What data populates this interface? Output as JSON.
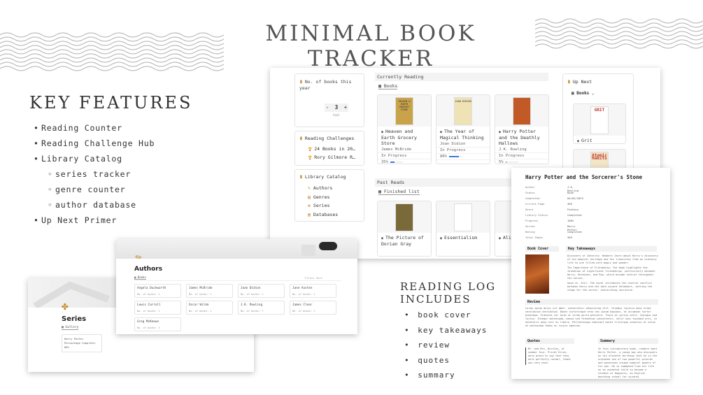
{
  "title": "MINIMAL BOOK TRACKER",
  "key_features": {
    "title": "KEY FEATURES",
    "items": [
      {
        "text": "Reading Counter",
        "level": 0
      },
      {
        "text": "Reading Challenge Hub",
        "level": 0
      },
      {
        "text": "Library Catalog",
        "level": 0
      },
      {
        "text": "series tracker",
        "level": 1
      },
      {
        "text": "genre counter",
        "level": 1
      },
      {
        "text": "author database",
        "level": 1
      },
      {
        "text": "Up Next Primer",
        "level": 0
      }
    ]
  },
  "reading_log": {
    "title_line1": "READING LOG",
    "title_line2": "INCLUDES",
    "items": [
      "book cover",
      "key takeaways",
      "review",
      "quotes",
      "summary"
    ]
  },
  "dashboard": {
    "counter": {
      "label": "No. of books this year",
      "value": "3",
      "minus": "-",
      "plus": "+",
      "sub": "Goal"
    },
    "challenges": {
      "label": "Reading Challenges",
      "items": [
        "24 Books in 20…",
        "Rory Gilmore R…"
      ]
    },
    "catalog": {
      "label": "Library Catalog",
      "items": [
        {
          "icon": "pencil-icon",
          "label": "Authors"
        },
        {
          "icon": "books-icon",
          "label": "Genres"
        },
        {
          "icon": "clover-icon",
          "label": "Series"
        },
        {
          "icon": "database-icon",
          "label": "Databases"
        }
      ]
    },
    "currently_reading": {
      "header": "Currently Reading",
      "tab": "Books",
      "books": [
        {
          "title": "Heaven and Earth Grocery Store",
          "author": "James McBride",
          "status": "In Progress",
          "progress_label": "35%",
          "progress": 0.35,
          "cover_color": "#c9a34a",
          "cover_text": "HEAVEN & EARTH GROCERY STORE"
        },
        {
          "title": "The Year of Magical Thinking",
          "author": "Joan Didion",
          "status": "In Progress",
          "progress_label": "80%",
          "progress": 0.8,
          "cover_color": "#efe2b5",
          "cover_text": "JOAN DIDION"
        },
        {
          "title": "Harry Potter and the Deathly Hallows",
          "author": "J.K. Rowling",
          "status": "In Progress",
          "progress_label": "5%",
          "progress": 0.05,
          "cover_color": "#c25a28",
          "cover_text": ""
        }
      ]
    },
    "past_reads": {
      "header": "Past Reads",
      "tab": "Finished list",
      "books": [
        {
          "title": "The Picture of Dorian Gray",
          "cover_color": "#7a6a3a"
        },
        {
          "title": "Essentialism",
          "cover_color": "#ffffff"
        },
        {
          "title": "Ali… Won…",
          "cover_color": "#5a8a9a"
        }
      ]
    },
    "up_next": {
      "header": "Up Next",
      "tab": "Books",
      "books": [
        {
          "title": "Grit",
          "cover_color": "#ffffff",
          "cover_text": "GRIT"
        },
        {
          "title": "Atomic Habits",
          "cover_color": "#f2e6c9",
          "cover_text": "Atomic Habits"
        }
      ]
    }
  },
  "harry_potter": {
    "title": "Harry Potter and the Sorcerer's Stone",
    "props": [
      {
        "k": "Author",
        "v": "J.K. Rowling"
      },
      {
        "k": "Status",
        "v": "Done"
      },
      {
        "k": "Completed",
        "v": "04/02/2023"
      },
      {
        "k": "Current Page",
        "v": "309"
      },
      {
        "k": "Genre",
        "v": "Fantasy"
      },
      {
        "k": "Library Status",
        "v": "Completed"
      },
      {
        "k": "Progress",
        "v": "100%"
      },
      {
        "k": "Series",
        "v": "Harry Potter"
      },
      {
        "k": "Rating",
        "v": "Completed"
      },
      {
        "k": "Total Pages",
        "v": "309"
      }
    ],
    "cover_label": "Book Cover",
    "takeaways_label": "Key Takeaways",
    "takeaways": [
      "Discovery of Identity: Readers learn about Harry's discovery of his magical heritage and his transition from an ordinary life to one filled with magic and wonder.",
      "The Importance of Friendship: The book highlights the formation of significant friendships, particularly between Harry, Hermione, and Ron, which become central throughout the series.",
      "Good vs. Evil: The novel introduces the central conflict between Harry and the dark wizard Voldemort, setting the stage for the series' overarching narrative."
    ],
    "review_label": "Review",
    "review_text": "Lorem ipsum dolor sit amet, consectetur adipiscing elit. Vivamus lacinia odio vitae vestibulum vestibulum. Donec scelerisque eros nec ipsum dapibus, at accumsan tortor bibendum. Praesent vel enim ut lorem porta pharetra. Fusce et varius velit. Quisque sed lectus. Integer malesuada, massa sed fermentum consectetur, velit nunc euismod orci, in hendrerit odio nisl eu libero. Pellentesque habitant morbi tristique senectus et netus et malesuada fames ac turpis egestas.",
    "quotes_label": "Quotes",
    "quote_text": "Mr. and Mrs. Dursley, of number four, Privet Drive, were proud to say that they were perfectly normal, thank you very much.",
    "summary_label": "Summary",
    "summary_text": "In this introductory book, readers meet Harry Potter, a young boy who discovers on his eleventh birthday that he is the orphaned son of two powerful wizards and possesses unique magical powers of his own. He is summoned from his life as an unwanted child to become a student at Hogwarts, an English boarding school for wizards."
  },
  "authors": {
    "title": "Authors",
    "tab": "Books",
    "toolbar": "Filter Sort",
    "cells": [
      {
        "name": "Angela Duckworth",
        "sub": "No. of books: 1"
      },
      {
        "name": "James McBride",
        "sub": "No. of books: 1"
      },
      {
        "name": "Joan Didion",
        "sub": "No. of books: 1"
      },
      {
        "name": "Jane Austen",
        "sub": "No. of books: 1"
      },
      {
        "name": "Lewis Carroll",
        "sub": "No. of books: 1"
      },
      {
        "name": "Oscar Wilde",
        "sub": "No. of books: 1"
      },
      {
        "name": "J.K. Rowling",
        "sub": "No. of books: 7"
      },
      {
        "name": "James Clear",
        "sub": "No. of books: 1"
      },
      {
        "name": "Greg McKeown",
        "sub": "No. of books: 1"
      }
    ]
  },
  "series": {
    "title": "Series",
    "tab": "Gallery",
    "card_name": "Harry Potter",
    "card_label": "Percentage Complete:",
    "card_value": "86%"
  }
}
